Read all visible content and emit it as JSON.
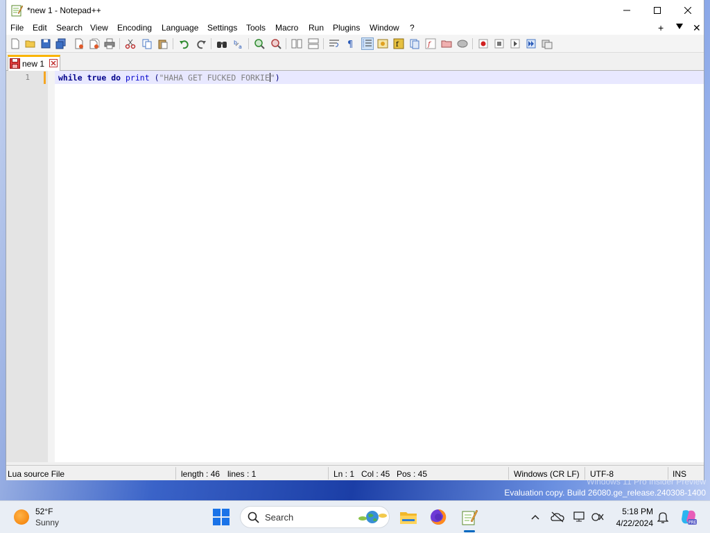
{
  "window": {
    "title": "*new 1 - Notepad++"
  },
  "menu": [
    "File",
    "Edit",
    "Search",
    "View",
    "Encoding",
    "Language",
    "Settings",
    "Tools",
    "Macro",
    "Run",
    "Plugins",
    "Window",
    "?"
  ],
  "menu_right": {
    "plus": "+",
    "close": "✕"
  },
  "tabs": [
    {
      "label": "new 1",
      "modified": true
    }
  ],
  "editor": {
    "line_number": "1",
    "code": {
      "kw1": "while",
      "kw2": "true",
      "kw3": "do",
      "fn": "print",
      "open": "(",
      "str_before_caret": "\"HAHA GET FUCKED FORKIE",
      "str_after_caret": "\"",
      "close": ")"
    }
  },
  "status": {
    "file_type": "Lua source File",
    "length": "length : 46",
    "lines": "lines : 1",
    "ln": "Ln : 1",
    "col": "Col : 45",
    "pos": "Pos : 45",
    "eol": "Windows (CR LF)",
    "encoding": "UTF-8",
    "mode": "INS"
  },
  "watermark": {
    "line1": "Windows 11 Pro Insider Preview",
    "line2": "Evaluation copy. Build 26080.ge_release.240308-1400"
  },
  "taskbar": {
    "weather_temp": "52°F",
    "weather_desc": "Sunny",
    "search_label": "Search",
    "time": "5:18 PM",
    "date": "4/22/2024"
  },
  "colors": {
    "accent": "#0067c0",
    "tab_active": "#fab400",
    "keyword": "#00008b",
    "string": "#808080",
    "current_line": "#e8e8ff"
  }
}
